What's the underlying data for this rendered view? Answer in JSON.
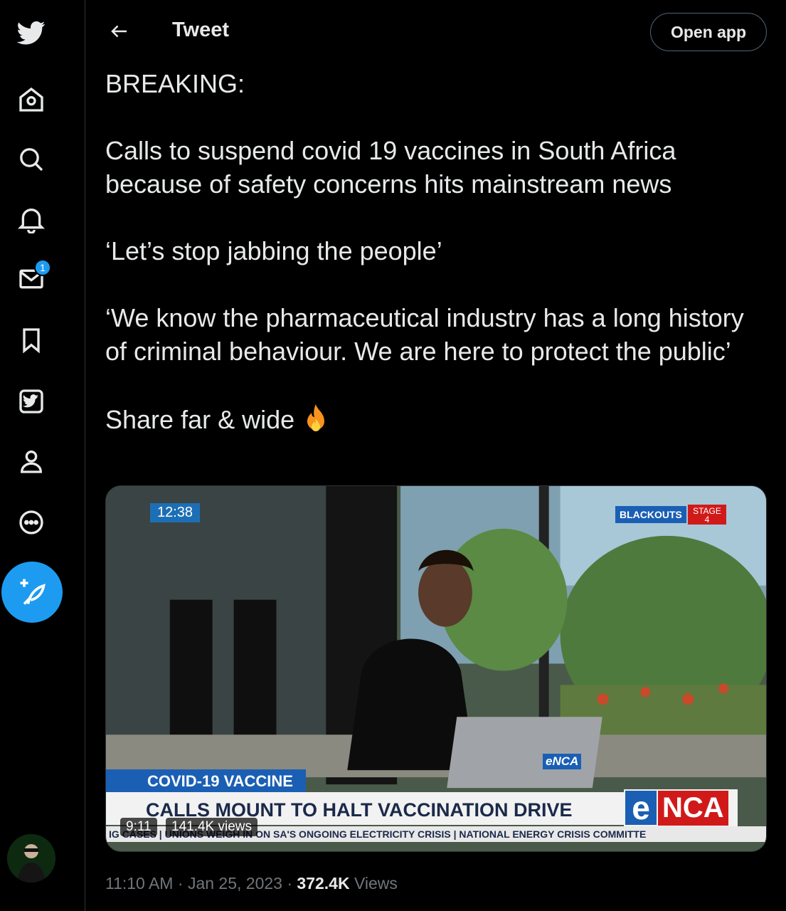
{
  "sidebar": {
    "notification_badge": "1"
  },
  "header": {
    "title": "Tweet",
    "open_app_label": "Open app"
  },
  "tweet": {
    "paragraphs": [
      "BREAKING:",
      "Calls to suspend covid 19 vaccines in South Africa because of safety concerns hits mainstream news",
      "‘Let’s stop jabbing the people’",
      "‘We know the pharmaceutical industry has a long history of criminal behaviour. We are here to protect the public’",
      "Share far & wide"
    ]
  },
  "video": {
    "timecode": "12:38",
    "blackouts_label": "BLACKOUTS",
    "stage_label": "STAGE",
    "stage_number": "4",
    "topic_band": "COVID-19 VACCINE",
    "headline": "CALLS MOUNT TO HALT VACCINATION DRIVE",
    "logo_e": "e",
    "logo_nca": "NCA",
    "laptop_logo": "eNCA",
    "ticker": "IG CASES | UNIONS WEIGH IN ON SA'S ONGOING ELECTRICITY CRISIS  |  NATIONAL ENERGY CRISIS COMMITTE",
    "duration": "9:11",
    "views": "141.4K views"
  },
  "meta": {
    "time": "11:10 AM",
    "separator1": " · ",
    "date": "Jan 25, 2023",
    "separator2": " · ",
    "view_count": "372.4K",
    "views_label": " Views"
  },
  "colors": {
    "accent": "#1d9bf0",
    "background": "#000000",
    "text": "#e7e9ea",
    "muted": "#71767b"
  }
}
